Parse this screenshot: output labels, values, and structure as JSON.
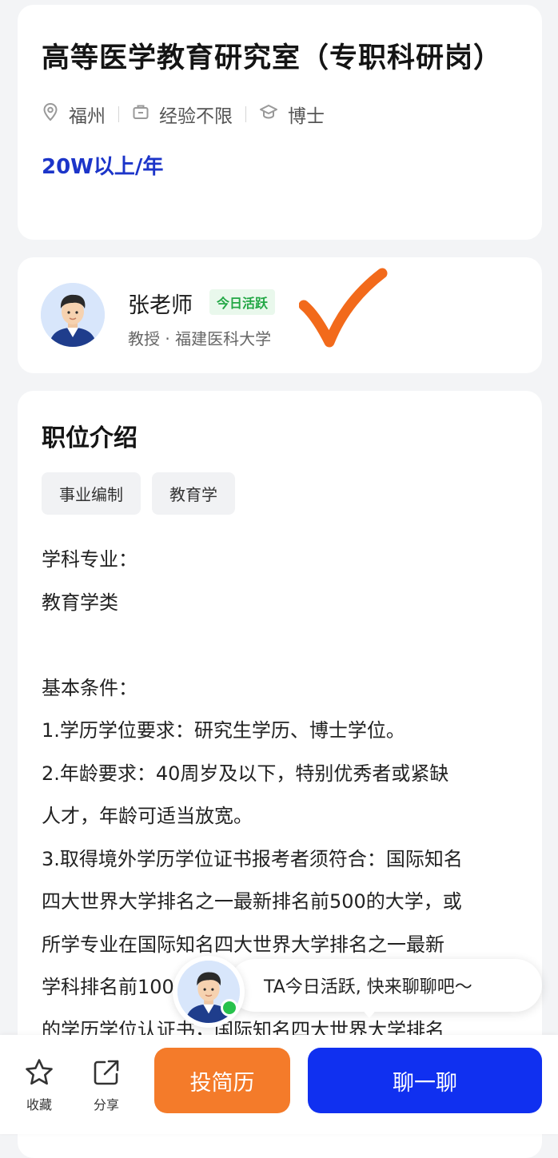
{
  "job": {
    "title": "高等医学教育研究室（专职科研岗）",
    "location": "福州",
    "experience": "经验不限",
    "education": "博士",
    "salary": "20W以上/年"
  },
  "recruiter": {
    "name": "张老师",
    "status": "今日活跃",
    "subtitle": "教授 · 福建医科大学"
  },
  "description": {
    "section_title": "职位介绍",
    "tags": [
      "事业编制",
      "教育学"
    ],
    "lines": [
      "学科专业：",
      "教育学类",
      "",
      "基本条件：",
      "1.学历学位要求：研究生学历、博士学位。",
      "2.年龄要求：40周岁及以下，特别优秀者或紧缺",
      "人才，年龄可适当放宽。",
      "3.取得境外学历学位证书报考者须符合：国际知名",
      "四大世界大学排名之一最新排名前500的大学，或",
      "所学专业在国际知名四大世界大学排名之一最新",
      "学科排名前100",
      "的学历学位认证书，国际知名四大世界大学排名"
    ]
  },
  "chat_prompt": {
    "text": "TA今日活跃, 快来聊聊吧～"
  },
  "bottom_bar": {
    "favorite_label": "收藏",
    "share_label": "分享",
    "resume_button": "投简历",
    "chat_button": "聊一聊"
  },
  "colors": {
    "salary": "#1c35c9",
    "active_badge": "#22a745",
    "resume_button": "#f47b2a",
    "chat_button": "#1030f0",
    "check_mark": "#f26a1b"
  },
  "icons": {
    "location": "location-pin-icon",
    "experience": "briefcase-icon",
    "education": "graduation-cap-icon",
    "favorite": "star-icon",
    "share": "share-icon"
  }
}
